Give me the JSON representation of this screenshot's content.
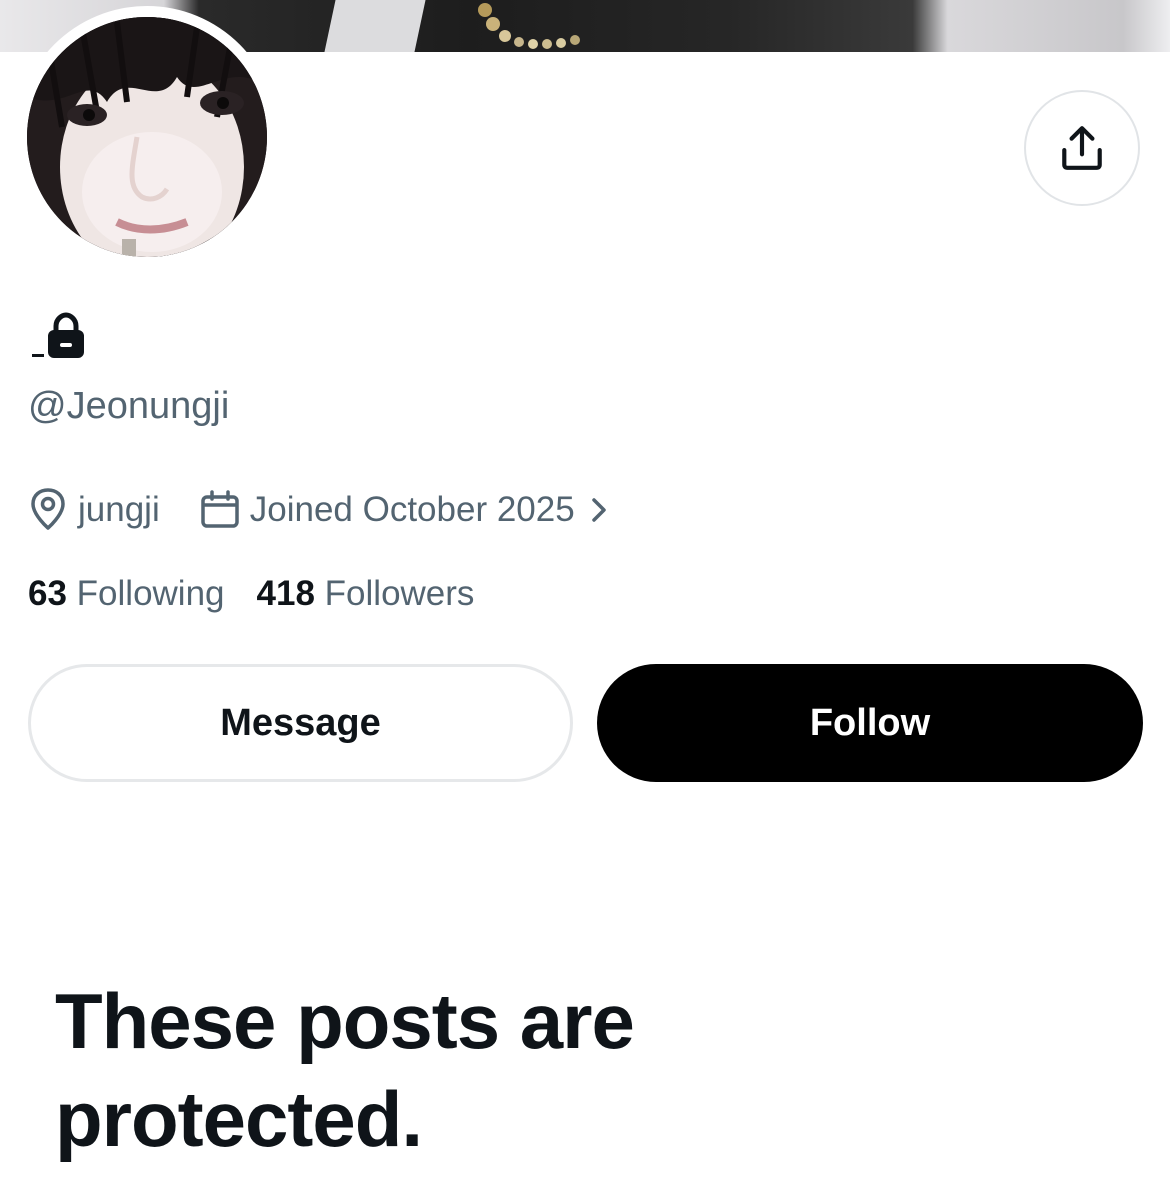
{
  "profile": {
    "handle": "@Jeonungji",
    "location": "jungji",
    "joined": "Joined October 2025",
    "following_count": "63",
    "following_label": "Following",
    "followers_count": "418",
    "followers_label": "Followers"
  },
  "actions": {
    "message_label": "Message",
    "follow_label": "Follow"
  },
  "protected_notice": {
    "title": "These posts are protected."
  },
  "icons": {
    "share": "share-icon",
    "lock": "lock-icon",
    "location": "location-pin-icon",
    "calendar": "calendar-icon",
    "chevron": "chevron-right-icon"
  },
  "colors": {
    "text_primary": "#0f1419",
    "text_secondary": "#536471",
    "follow_button": "#000000",
    "border": "#e6e8ea"
  }
}
